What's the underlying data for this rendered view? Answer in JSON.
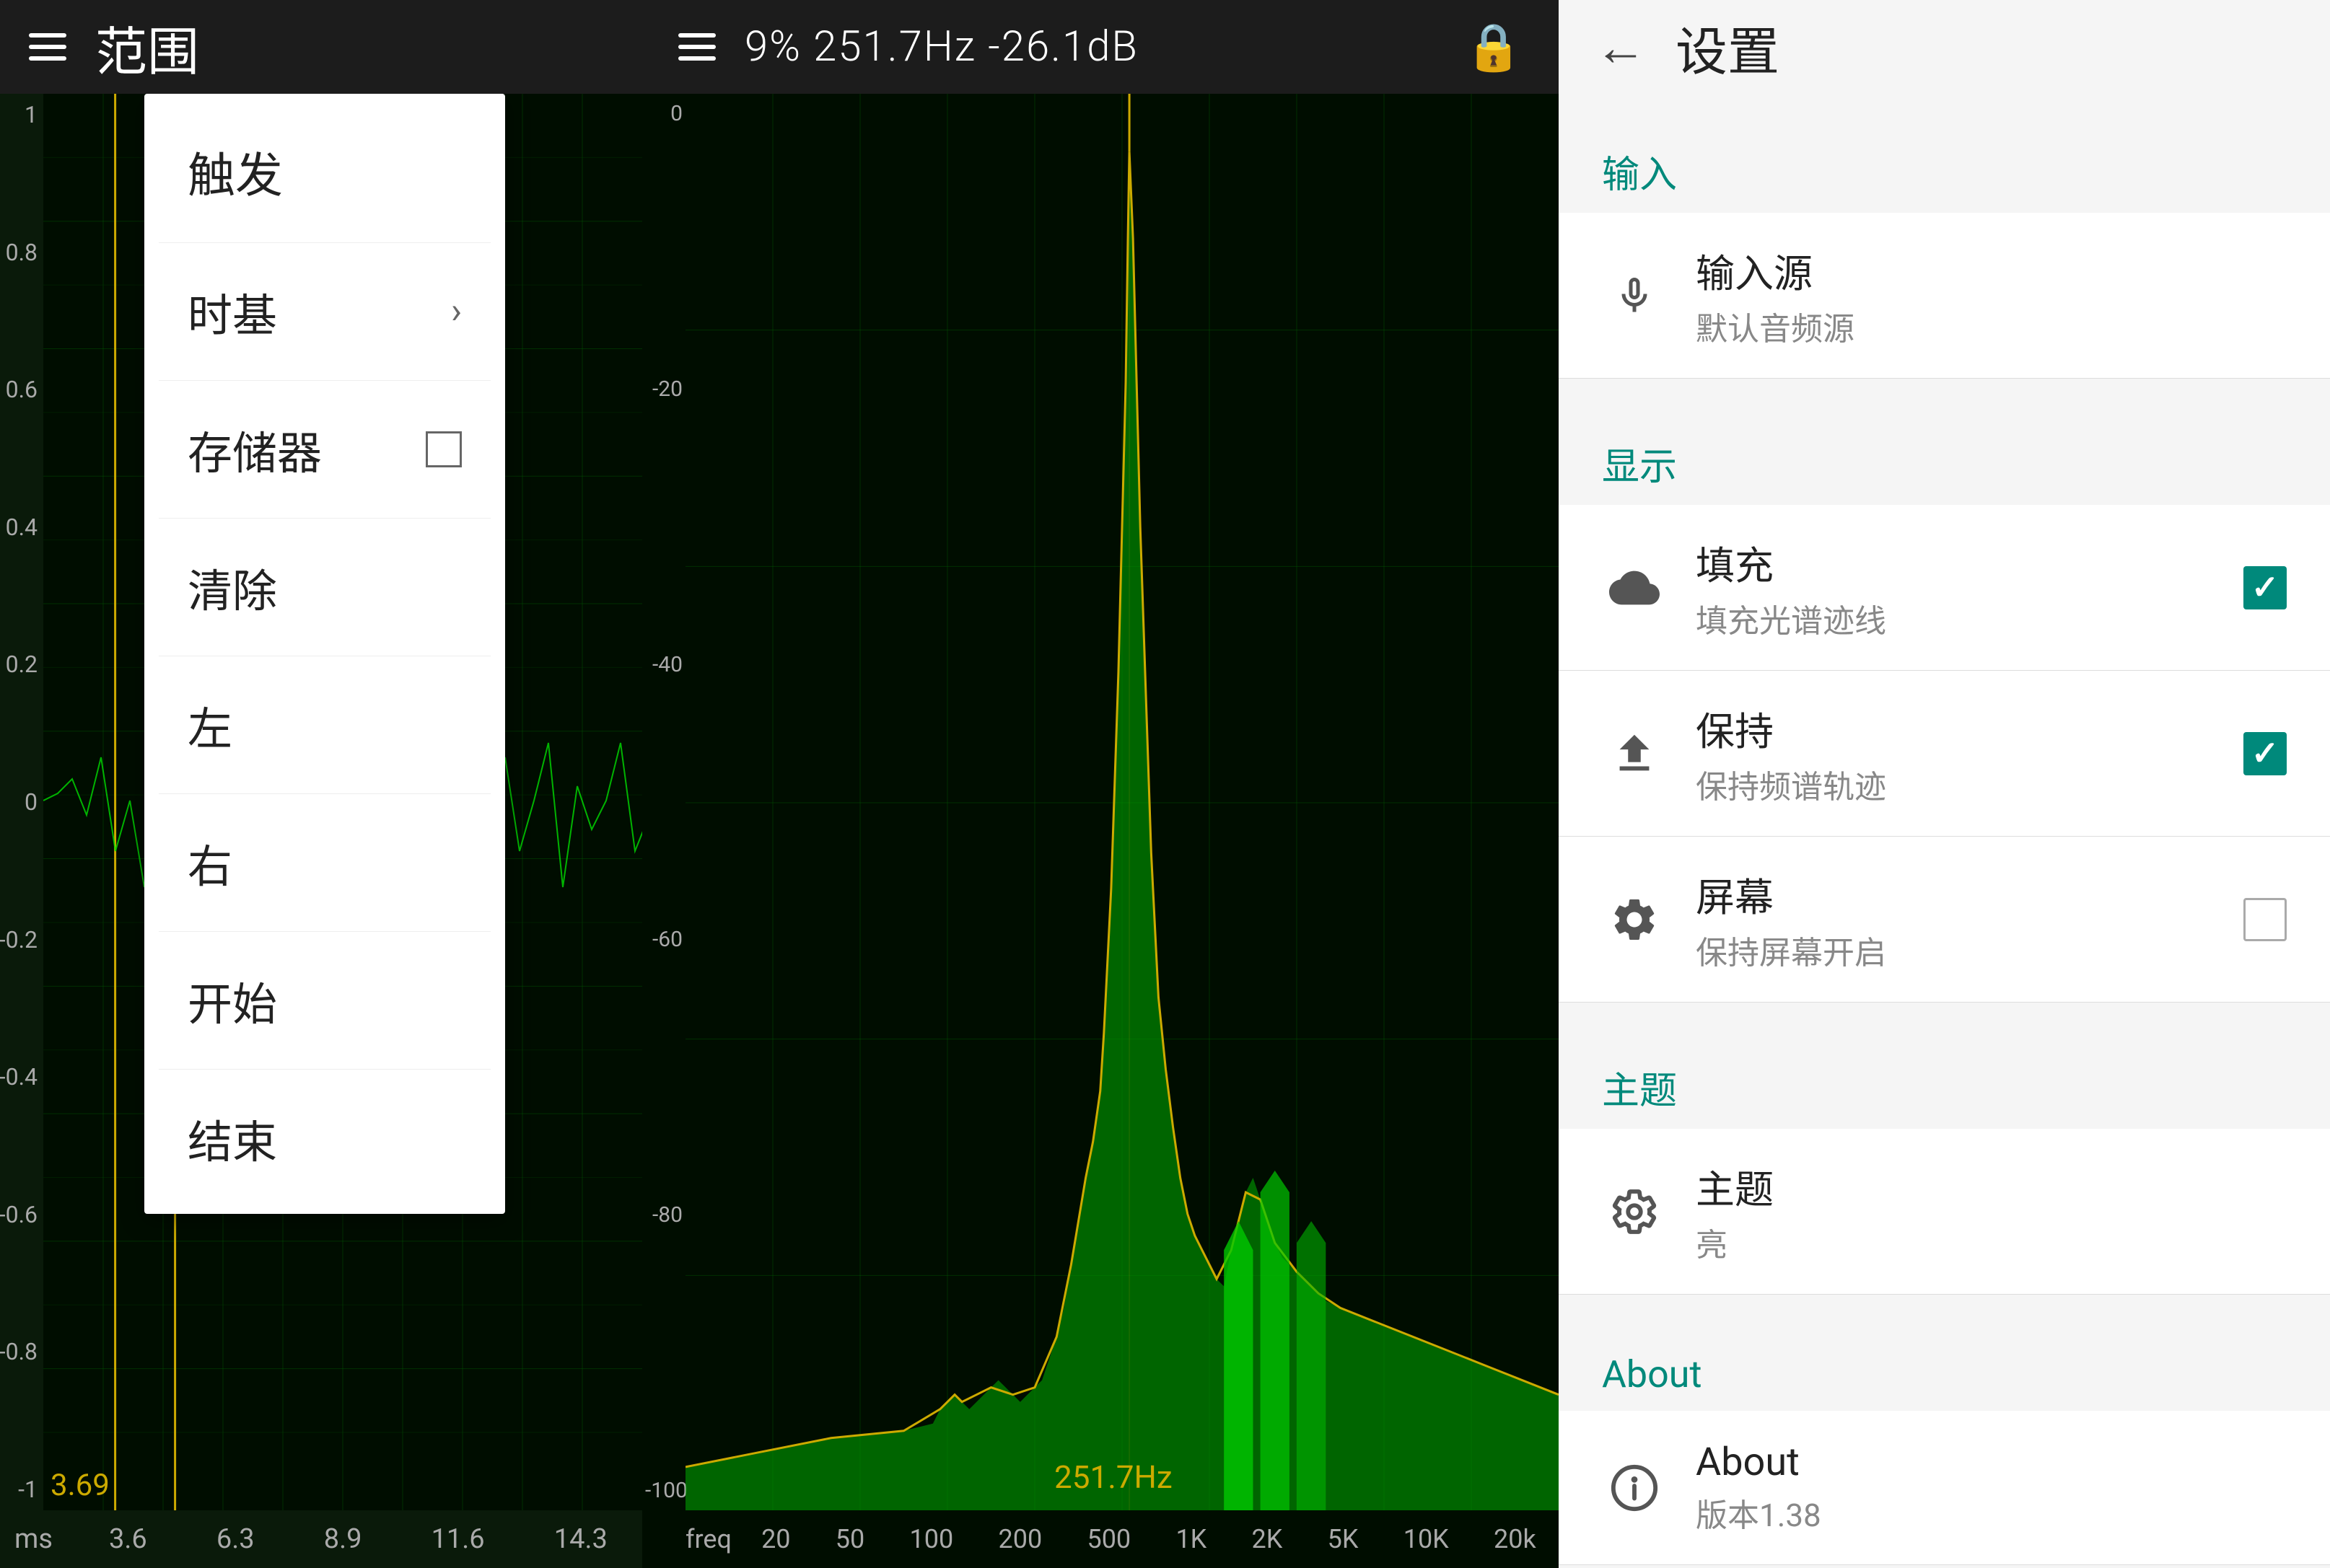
{
  "header": {
    "left": {
      "hamburger_label": "menu",
      "title": "范围"
    },
    "center": {
      "hamburger_label": "menu",
      "status": "9%  251.7Hz  -26.1dB",
      "lock_symbol": "🔒"
    },
    "right": {
      "back_symbol": "←",
      "title": "设置"
    }
  },
  "dropdown": {
    "title": "触发",
    "items": [
      {
        "label": "时基",
        "has_arrow": true,
        "has_checkbox": false
      },
      {
        "label": "存储器",
        "has_arrow": false,
        "has_checkbox": true,
        "checked": false
      },
      {
        "label": "清除",
        "has_arrow": false,
        "has_checkbox": false
      },
      {
        "label": "左",
        "has_arrow": false,
        "has_checkbox": false
      },
      {
        "label": "右",
        "has_arrow": false,
        "has_checkbox": false
      },
      {
        "label": "开始",
        "has_arrow": false,
        "has_checkbox": false
      },
      {
        "label": "结束",
        "has_arrow": false,
        "has_checkbox": false
      }
    ]
  },
  "oscilloscope": {
    "label_value": "0.00",
    "bottom_label": "3.69",
    "x_axis_unit": "ms",
    "x_labels": [
      "3.6",
      "6.3",
      "8.9",
      "11.6",
      "14.3"
    ]
  },
  "spectrum": {
    "freq_label": "251.7Hz",
    "x_labels": [
      "20",
      "50",
      "100",
      "200",
      "500",
      "1K",
      "2K",
      "5K",
      "10K",
      "20k"
    ],
    "x_prefix": "freq"
  },
  "settings": {
    "sections": [
      {
        "header": "输入",
        "items": [
          {
            "icon": "mic",
            "title": "输入源",
            "subtitle": "默认音频源",
            "control": "none"
          }
        ]
      },
      {
        "header": "显示",
        "items": [
          {
            "icon": "cloud",
            "title": "填充",
            "subtitle": "填充光谱迹线",
            "control": "checked"
          },
          {
            "icon": "upload",
            "title": "保持",
            "subtitle": "保持频谱轨迹",
            "control": "checked"
          },
          {
            "icon": "gear",
            "title": "屏幕",
            "subtitle": "保持屏幕开启",
            "control": "unchecked"
          }
        ]
      },
      {
        "header": "主题",
        "items": [
          {
            "icon": "gear-outline",
            "title": "主题",
            "subtitle": "亮",
            "control": "none"
          }
        ]
      },
      {
        "header": "About",
        "items": [
          {
            "icon": "info",
            "title": "About",
            "subtitle": "版本1.38",
            "control": "none"
          }
        ]
      }
    ]
  }
}
